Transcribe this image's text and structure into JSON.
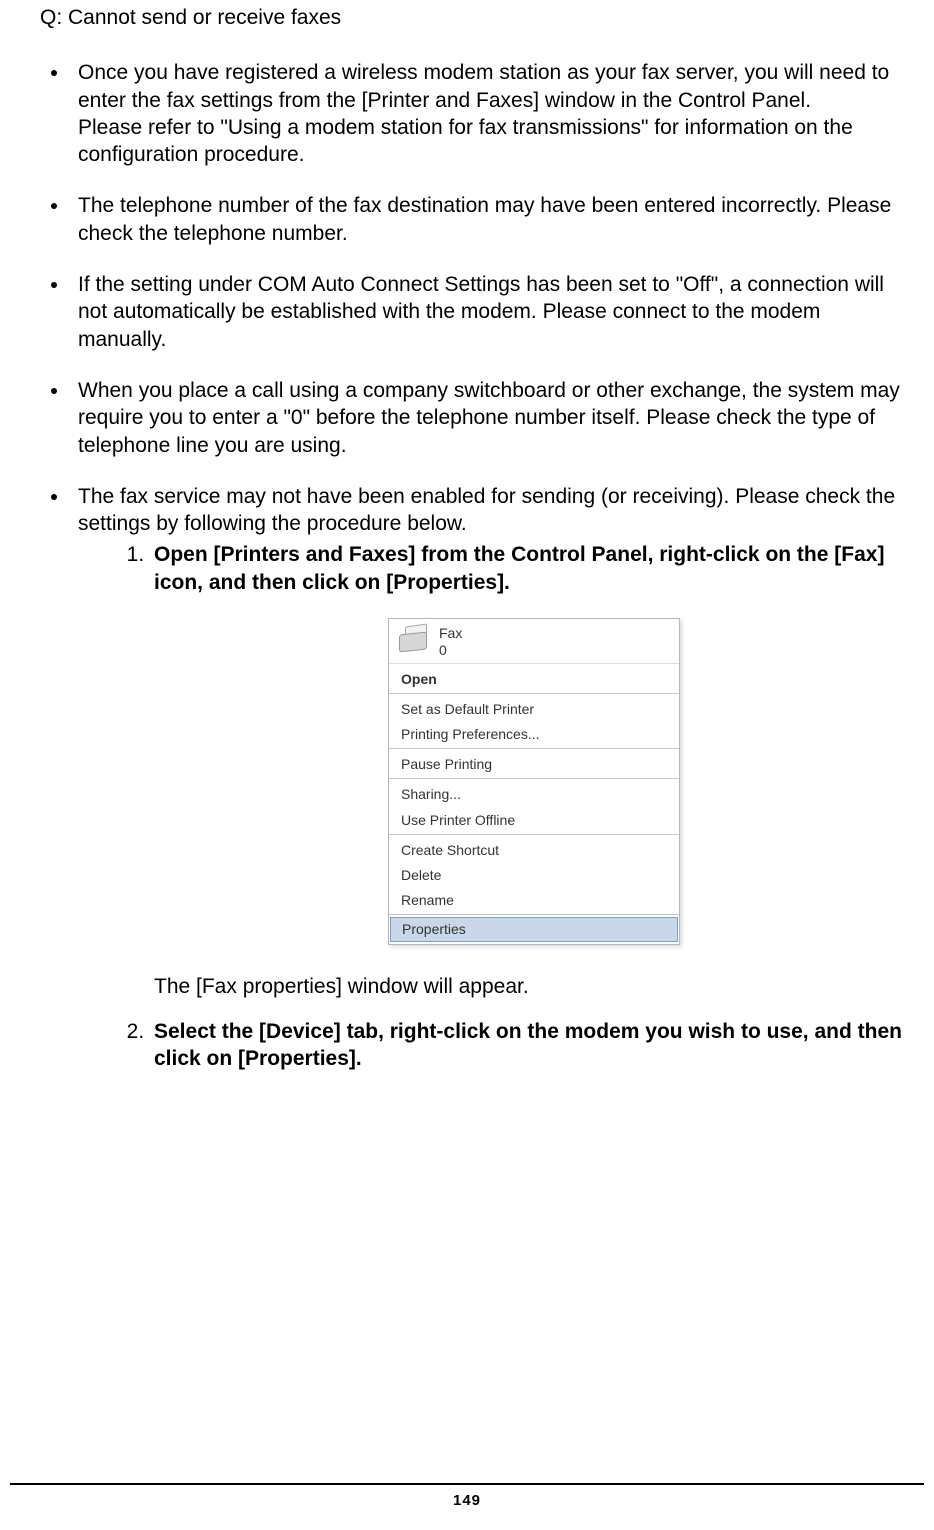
{
  "heading": "Q: Cannot send or receive faxes",
  "bullets": [
    {
      "paras": [
        "Once you have registered a wireless modem station as your fax server, you will need to enter the fax settings from the [Printer and Faxes] window in the Control Panel.",
        "Please refer to \"Using a modem station for fax transmissions\" for information on the configuration procedure."
      ]
    },
    {
      "paras": [
        "The telephone number of the fax destination may have been entered incorrectly. Please check the telephone number."
      ]
    },
    {
      "paras": [
        "If the setting under COM Auto Connect Settings has been set to \"Off\", a connection will not automatically be established with the modem. Please connect to the modem manually."
      ]
    },
    {
      "paras": [
        "When you place a call using a company switchboard or other exchange, the system may require you to enter a \"0\" before the telephone number itself. Please check the type of telephone line you are using."
      ]
    },
    {
      "paras": [
        "The fax service may not have been enabled for sending (or receiving). Please check the settings by following the procedure below."
      ]
    }
  ],
  "steps": {
    "s1": "Open [Printers and Faxes] from the Control Panel, right-click on the [Fax] icon, and then click on [Properties].",
    "s2": "Select the [Device] tab, right-click on the modem you wish to use, and then click on [Properties]."
  },
  "after_img": "The [Fax properties] window will appear.",
  "menu": {
    "title1": "Fax",
    "title2": "0",
    "items": [
      "Open",
      "Set as Default Printer",
      "Printing Preferences...",
      "Pause Printing",
      "Sharing...",
      "Use Printer Offline",
      "Create Shortcut",
      "Delete",
      "Rename",
      "Properties"
    ]
  },
  "page_number": "149"
}
